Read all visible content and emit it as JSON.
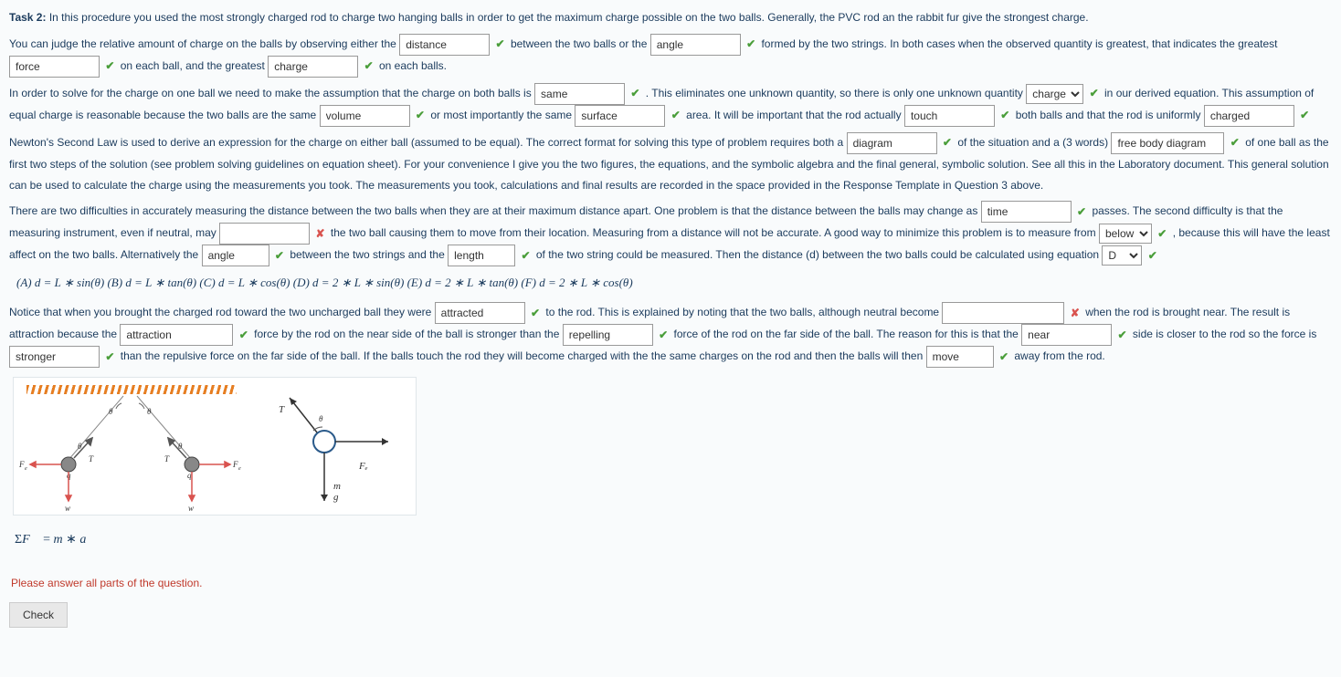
{
  "task_label": "Task 2:",
  "intro": "In this procedure you used the most strongly charged rod to charge two hanging balls in order to get the maximum charge possible on the two balls. Generally, the PVC rod an the rabbit fur give the strongest charge.",
  "p1": {
    "t1": "You can judge the relative amount of charge on the balls by observing either the",
    "i1": "distance",
    "t2": "between the two balls or the",
    "i2": "angle",
    "t3": "formed by the two strings. In both cases when the observed quantity is greatest, that indicates the greatest",
    "i3": "force",
    "t4": "on each ball, and the greatest",
    "i4": "charge",
    "t5": "on each balls."
  },
  "p2": {
    "t1": "In order to solve for the charge on one ball we need to make the assumption that the charge on both balls is",
    "i1": "same",
    "t2": ". This eliminates one unknown quantity, so there is only one unknown quantity",
    "i2": "charge",
    "t3": "in our derived equation. This assumption of equal charge is reasonable because the two balls are the same",
    "i3": "volume",
    "t4": "or most importantly the same",
    "i4": "surface",
    "t5": "area. It will be important that the rod actually",
    "i5": "touch",
    "t6": "both balls and that the rod is uniformly",
    "i6": "charged"
  },
  "p3": {
    "t1": "Newton's Second Law is used to derive an expression for the charge on either ball (assumed to be equal). The correct format for solving this type of problem requires both a",
    "i1": "diagram",
    "t2": "of the situation and a (3 words)",
    "i2": "free body diagram",
    "t3": "of one ball as the first two steps of the solution (see problem solving guidelines on equation sheet). For your convenience I give you the two figures, the equations, and the symbolic algebra and the final general, symbolic solution. See all this in the Laboratory document. This general solution can be used to calculate the charge using the measurements you took. The measurements you took, calculations and final results are recorded in the space provided in the Response Template in Question 3 above."
  },
  "p4": {
    "t1": "There are two difficulties in accurately measuring the distance between the two balls when they are at their maximum distance apart. One problem is that the distance between the balls may change as",
    "i1": "time",
    "t2": "passes. The second difficulty is that the measuring instrument, even if neutral, may",
    "i2": "",
    "t3": "the two ball causing them to move from their location. Measuring from a distance will not be accurate. A good way to minimize this problem is to measure from",
    "i3": "below",
    "t4": ", because this will have the least affect on the two balls. Alternatively the",
    "i4": "angle",
    "t5": "between the two strings and the",
    "i5": "length",
    "t6": "of the two string could be measured. Then the distance (d) between the two balls could be calculated using equation",
    "i6": "D"
  },
  "equations": "(A) d = L ∗ sin(θ)  (B) d = L ∗ tan(θ)  (C) d = L ∗ cos(θ)  (D) d = 2 ∗ L ∗ sin(θ)  (E) d = 2 ∗ L ∗ tan(θ)  (F) d = 2 ∗ L ∗ cos(θ)",
  "p5": {
    "t1": "Notice that when you brought the charged rod toward the two uncharged ball they were",
    "i1": "attracted",
    "t2": "to the rod. This is explained by noting that the two balls, although neutral become",
    "i2": "",
    "t3": "when the rod is brought near. The result is attraction because the",
    "i3": "attraction",
    "t4": "force by the rod on the near side of the ball is stronger than the",
    "i4": "repelling",
    "t5": "force of the rod on the far side of the ball. The reason for this is that the",
    "i5": "near",
    "t6": "side is closer to the rod so the force is",
    "i6": "stronger",
    "t7": "than the repulsive force on the far side of the ball. If the balls touch the rod they will become charged with the the same charges on the rod and then the balls will then",
    "i7": "move",
    "t8": "away from the rod."
  },
  "sigma_eq": "ΣF⃗ = m ∗ a⃗",
  "error_msg": "Please answer all parts of the question.",
  "check_btn": "Check",
  "fig_labels": {
    "T": "T",
    "Fe": "Fₑ",
    "m": "m",
    "g": "g",
    "theta": "θ",
    "q": "q",
    "w": "w"
  }
}
